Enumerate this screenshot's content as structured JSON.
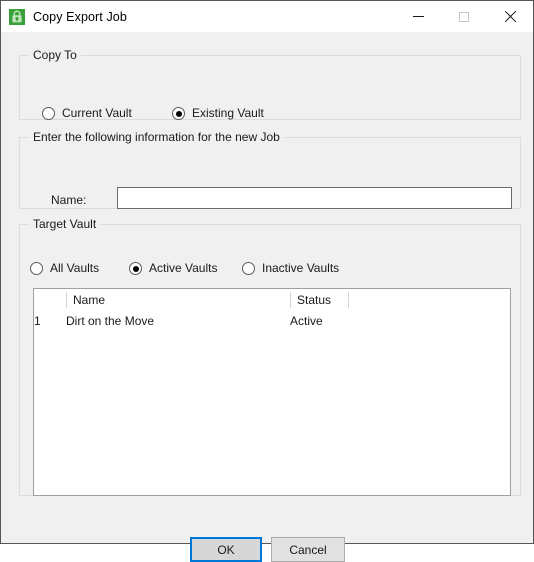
{
  "window": {
    "title": "Copy Export Job",
    "icon": "vault-lock-icon",
    "accent_blue": "#0078d7",
    "icon_green": "#3aa13a",
    "caption": {
      "minimize": "minimize-icon",
      "maximize": "maximize-icon",
      "close": "close-icon"
    }
  },
  "copy_to": {
    "legend": "Copy To",
    "options": [
      {
        "label": "Current Vault",
        "checked": false
      },
      {
        "label": "Existing Vault",
        "checked": true
      }
    ]
  },
  "new_job": {
    "legend": "Enter the following information for the new Job",
    "name_label": "Name:",
    "name_value": "",
    "name_placeholder": ""
  },
  "target_vault": {
    "legend": "Target Vault",
    "options": [
      {
        "label": "All Vaults",
        "checked": false
      },
      {
        "label": "Active Vaults",
        "checked": true
      },
      {
        "label": "Inactive Vaults",
        "checked": false
      }
    ],
    "grid": {
      "columns": [
        "",
        "Name",
        "Status"
      ],
      "rows": [
        {
          "num": "1",
          "name": "Dirt on the Move",
          "status": "Active"
        }
      ]
    }
  },
  "footer": {
    "ok_label": "OK",
    "cancel_label": "Cancel"
  }
}
